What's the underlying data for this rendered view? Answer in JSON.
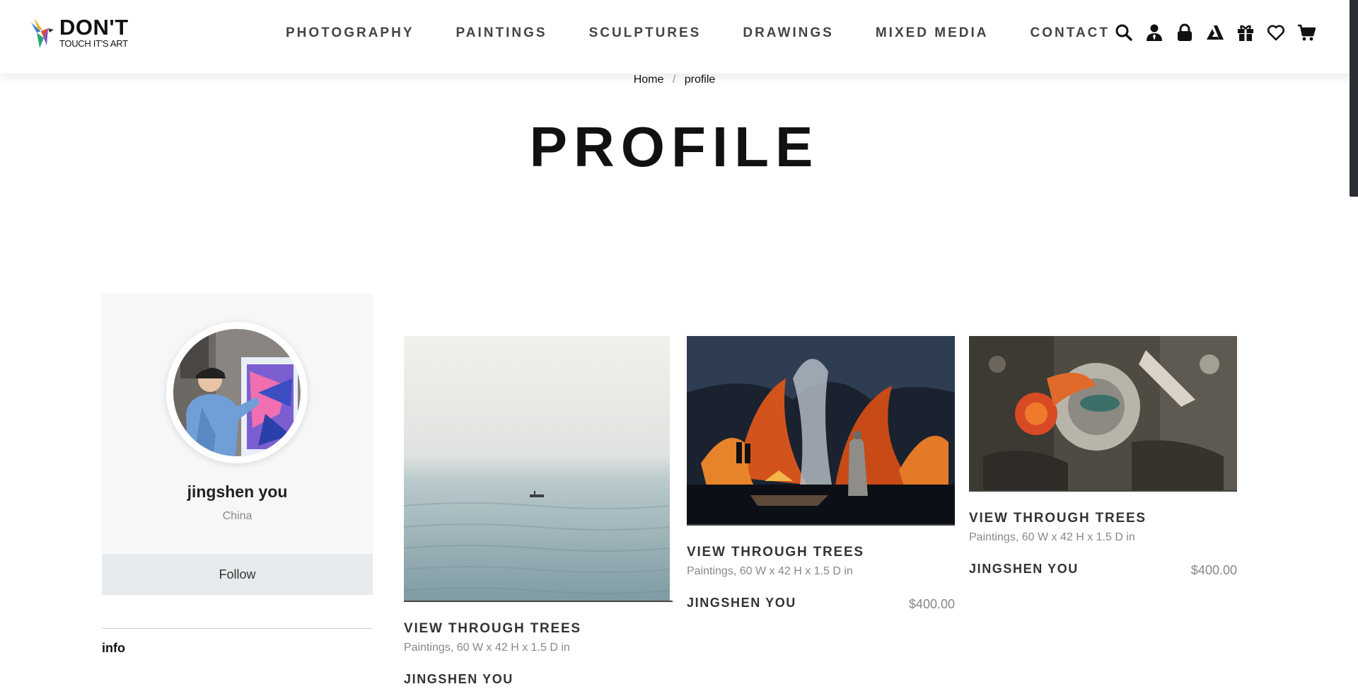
{
  "brand": {
    "title": "DON'T",
    "subtitle": "TOUCH IT'S ART"
  },
  "nav": [
    "PHOTOGRAPHY",
    "PAINTINGS",
    "SCULPTURES",
    "DRAWINGS",
    "MIXED MEDIA",
    "CONTACT"
  ],
  "header_icons": [
    "search-icon",
    "user-icon",
    "lock-icon",
    "artist-logo-icon",
    "gift-icon",
    "heart-icon",
    "cart-icon"
  ],
  "breadcrumb": {
    "home": "Home",
    "separator": "/",
    "current": "profile"
  },
  "page_title": "PROFILE",
  "profile": {
    "name": "jingshen you",
    "country": "China",
    "follow_label": "Follow",
    "info_label": "info"
  },
  "artworks": [
    {
      "title": "VIEW THROUGH TREES",
      "meta": "Paintings, 60 W x 42 H x 1.5 D in",
      "artist": "JINGSHEN YOU",
      "price": ""
    },
    {
      "title": "VIEW THROUGH TREES",
      "meta": "Paintings, 60 W x 42 H x 1.5 D in",
      "artist": "JINGSHEN YOU",
      "price": "$400.00"
    },
    {
      "title": "VIEW THROUGH TREES",
      "meta": "Paintings, 60 W x 42 H x 1.5 D in",
      "artist": "JINGSHEN YOU",
      "price": "$400.00"
    }
  ],
  "colors": {
    "accent_dark": "#111111",
    "muted": "#888888",
    "card_bg": "#f6f7f8",
    "button_bg": "#e8ebed"
  }
}
